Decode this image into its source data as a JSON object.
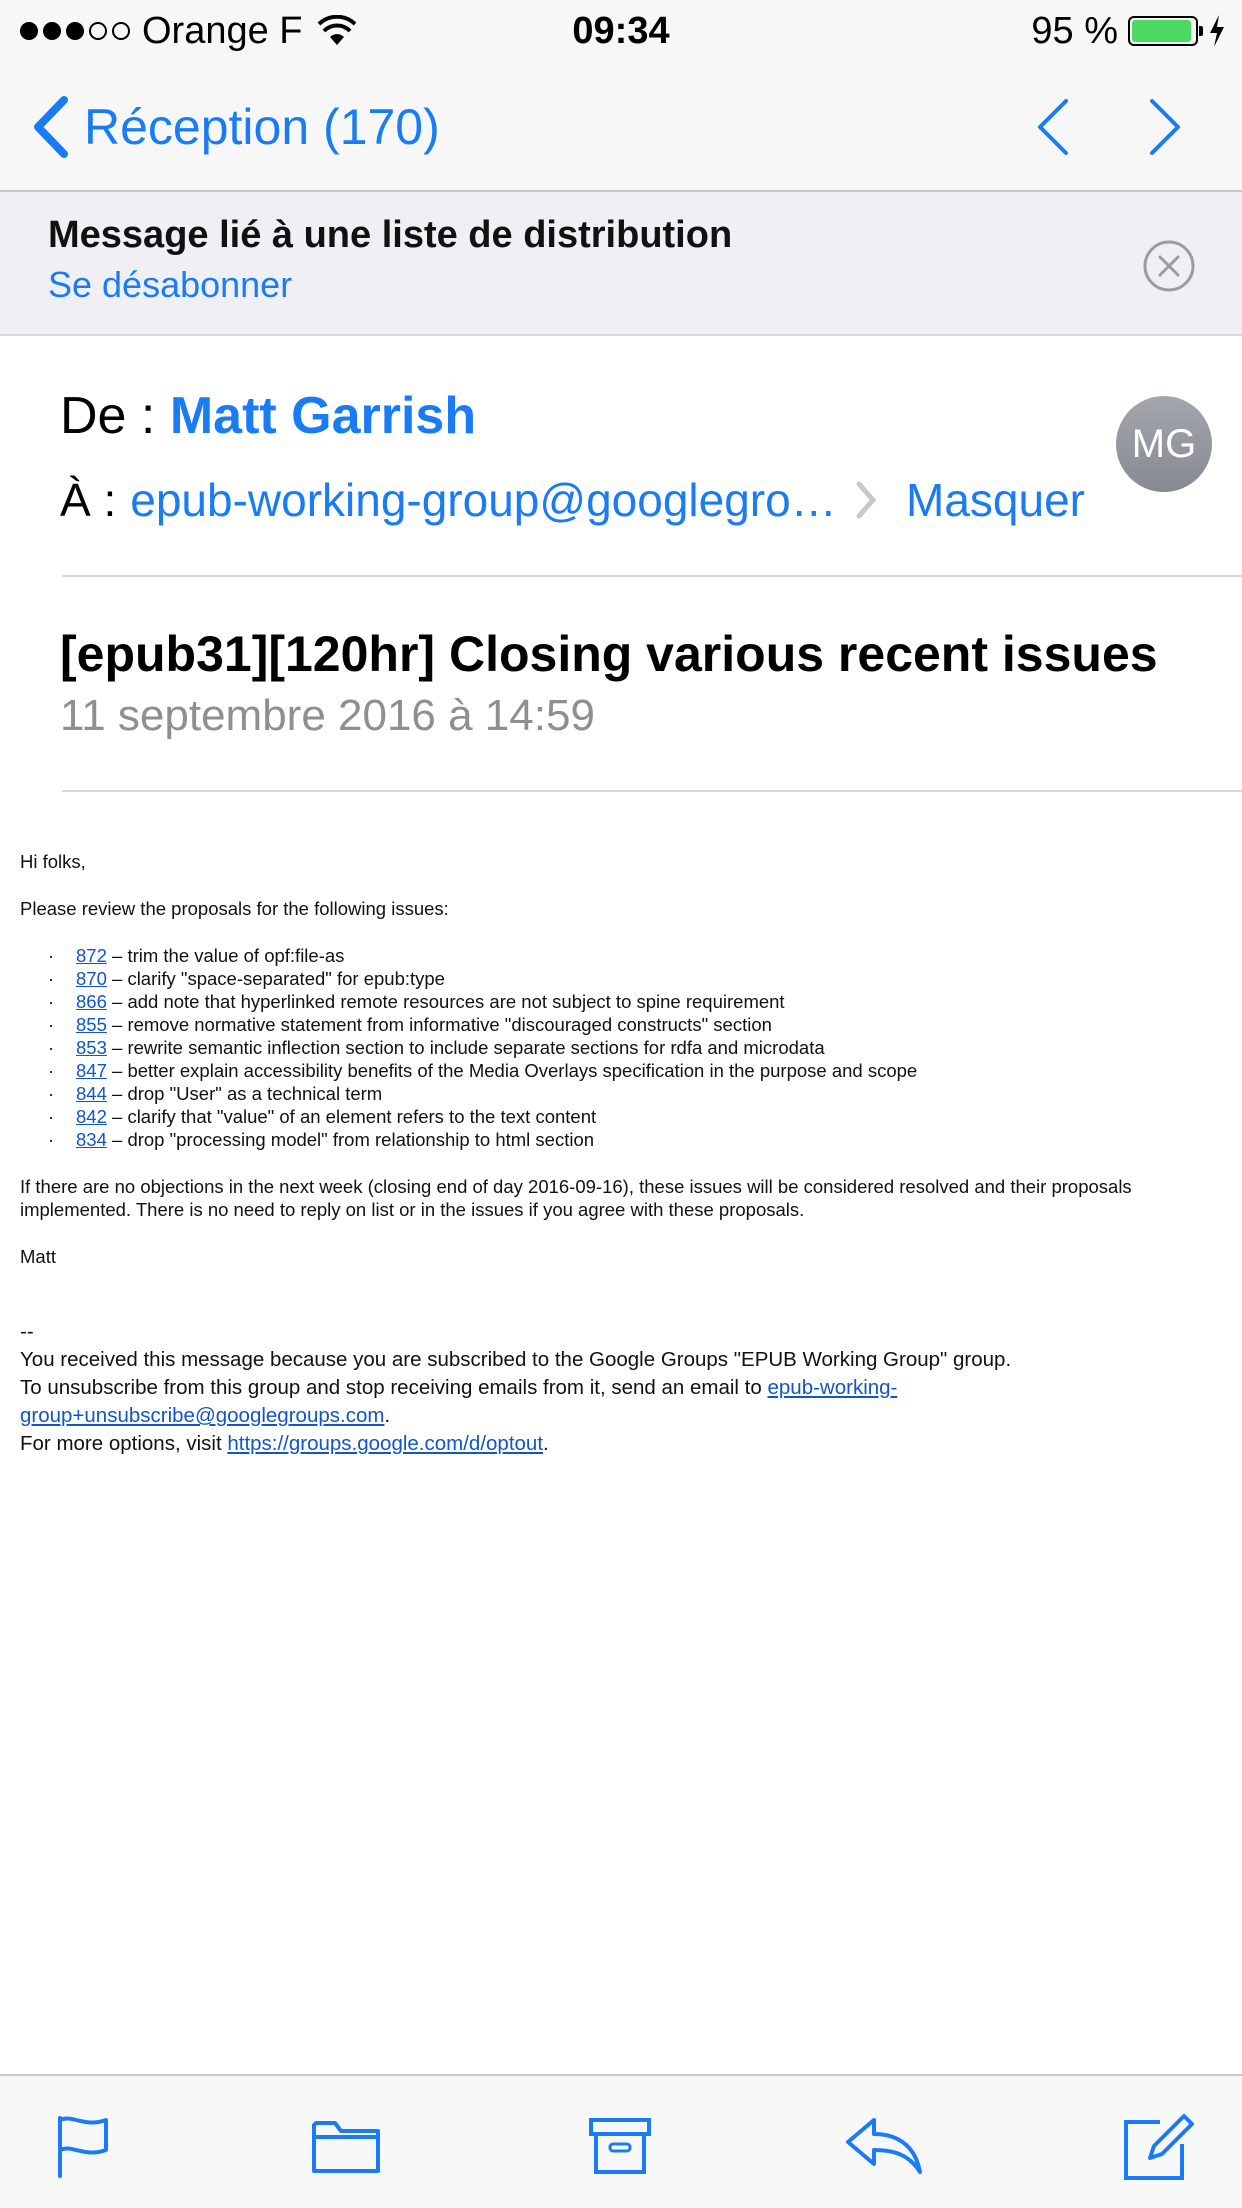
{
  "status_bar": {
    "carrier": "Orange F",
    "time": "09:34",
    "battery": "95 %",
    "battery_level": 0.95,
    "signal_bars": 3
  },
  "nav": {
    "back_label": "Réception (170)",
    "accent_color": "#1a7cf5"
  },
  "banner": {
    "title": "Message lié à une liste de distribution",
    "link": "Se désabonner"
  },
  "header": {
    "from_label": "De :",
    "from_name": "Matt Garrish",
    "to_label": "À :",
    "to_address": "epub-working-group@googlegro…",
    "hide_label": "Masquer",
    "avatar_initials": "MG",
    "subject": "[epub31][120hr] Closing various recent issues",
    "date": "11 septembre 2016 à 14:59"
  },
  "body": {
    "greeting": "Hi folks,",
    "intro": "Please review the proposals for the following issues:",
    "issues": [
      {
        "number": "872",
        "text": " – trim the value of opf:file-as"
      },
      {
        "number": "870",
        "text": " – clarify \"space-separated\" for epub:type"
      },
      {
        "number": "866",
        "text": " – add note that hyperlinked remote resources are not subject to spine requirement"
      },
      {
        "number": "855",
        "text": " – remove normative statement from informative \"discouraged constructs\" section"
      },
      {
        "number": "853",
        "text": " – rewrite semantic inflection section to include separate sections for rdfa and microdata"
      },
      {
        "number": "847",
        "text": " – better explain accessibility benefits of the Media Overlays specification in the purpose and scope"
      },
      {
        "number": "844",
        "text": " – drop \"User\" as a technical term"
      },
      {
        "number": "842",
        "text": " – clarify that \"value\" of an element refers to the text content"
      },
      {
        "number": "834",
        "text": " – drop \"processing model\" from relationship to html section"
      }
    ],
    "bullet": "·",
    "closing": "If there are no objections in the next week (closing end of day 2016-09-16), these issues will be considered resolved and their proposals implemented. There is no need to reply on list or in the issues if you agree with these proposals.",
    "signature": "Matt"
  },
  "footer": {
    "dashes": "--",
    "line1": "You received this message because you are subscribed to the Google Groups \"EPUB Working Group\" group.",
    "line2_prefix": "To unsubscribe from this group and stop receiving emails from it, send an email to ",
    "line2_link_a": "epub-working-",
    "line2_link_b": "group+unsubscribe@googlegroups.com",
    "line2_suffix": ".",
    "line3_prefix": "For more options, visit ",
    "line3_link": "https://groups.google.com/d/optout",
    "line3_suffix": "."
  },
  "toolbar": {
    "icons": [
      "flag-icon",
      "folder-icon",
      "archive-icon",
      "reply-icon",
      "compose-icon"
    ]
  }
}
